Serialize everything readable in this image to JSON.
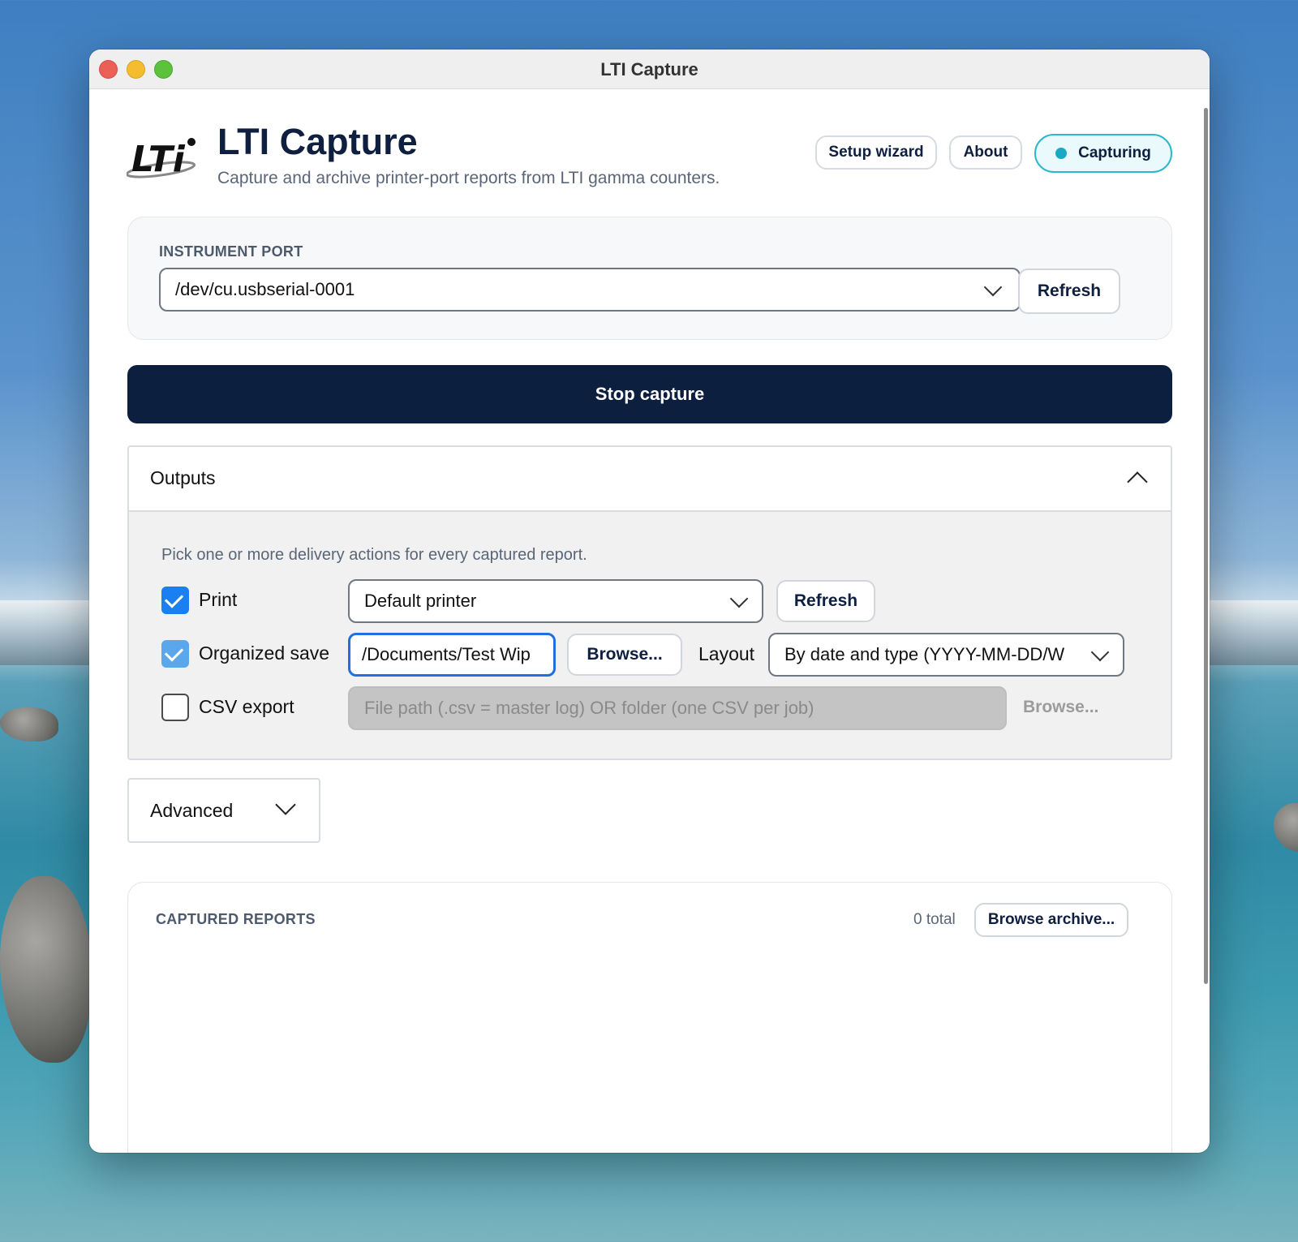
{
  "window": {
    "title": "LTI Capture"
  },
  "header": {
    "logo_text": "LTi",
    "title": "LTI Capture",
    "subtitle": "Capture and archive printer-port reports from LTI gamma counters.",
    "buttons": {
      "setup": "Setup wizard",
      "about": "About",
      "capturing": "Capturing"
    },
    "status_color": "#19a9c4"
  },
  "port": {
    "label": "INSTRUMENT PORT",
    "selected": "/dev/cu.usbserial-0001",
    "refresh": "Refresh"
  },
  "capture": {
    "stop_label": "Stop capture",
    "button_color": "#0c1f3f"
  },
  "outputs": {
    "title": "Outputs",
    "expanded": true,
    "hint": "Pick one or more delivery actions for every captured report.",
    "print": {
      "label": "Print",
      "checked": true,
      "printer": "Default printer",
      "refresh": "Refresh"
    },
    "organized_save": {
      "label": "Organized save",
      "checked": true,
      "path": "/Documents/Test Wip",
      "browse": "Browse...",
      "layout_label": "Layout",
      "layout_value": "By date and type (YYYY-MM-DD/W"
    },
    "csv_export": {
      "label": "CSV export",
      "checked": false,
      "placeholder": "File path (.csv = master log) OR folder (one CSV per job)",
      "browse": "Browse..."
    }
  },
  "advanced": {
    "label": "Advanced",
    "expanded": false
  },
  "reports": {
    "label": "CAPTURED REPORTS",
    "count": "0 total",
    "browse_archive": "Browse archive..."
  },
  "icons": [
    "close-icon",
    "minimize-icon",
    "maximize-icon",
    "chevron-down-icon",
    "chevron-up-icon",
    "checkmark-icon",
    "status-dot-icon"
  ]
}
